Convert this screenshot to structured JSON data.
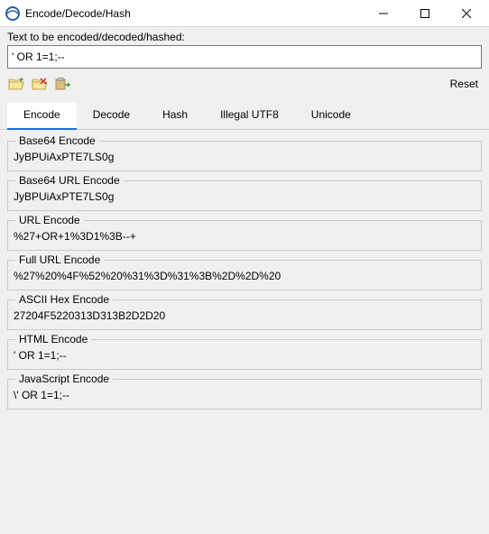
{
  "window": {
    "title": "Encode/Decode/Hash"
  },
  "input": {
    "label": "Text to be encoded/decoded/hashed:",
    "value": "' OR 1=1;-- "
  },
  "toolbar": {
    "reset": "Reset"
  },
  "tabs": [
    {
      "label": "Encode",
      "active": true
    },
    {
      "label": "Decode",
      "active": false
    },
    {
      "label": "Hash",
      "active": false
    },
    {
      "label": "Illegal UTF8",
      "active": false
    },
    {
      "label": "Unicode",
      "active": false
    }
  ],
  "results": [
    {
      "title": "Base64 Encode",
      "value": "JyBPUiAxPTE7LS0g"
    },
    {
      "title": "Base64 URL Encode",
      "value": "JyBPUiAxPTE7LS0g"
    },
    {
      "title": "URL Encode",
      "value": "%27+OR+1%3D1%3B--+"
    },
    {
      "title": "Full URL Encode",
      "value": "%27%20%4F%52%20%31%3D%31%3B%2D%2D%20"
    },
    {
      "title": "ASCII Hex Encode",
      "value": "27204F5220313D313B2D2D20"
    },
    {
      "title": "HTML Encode",
      "value": "' OR 1=1;-- "
    },
    {
      "title": "JavaScript Encode",
      "value": "\\' OR 1=1;-- "
    }
  ]
}
